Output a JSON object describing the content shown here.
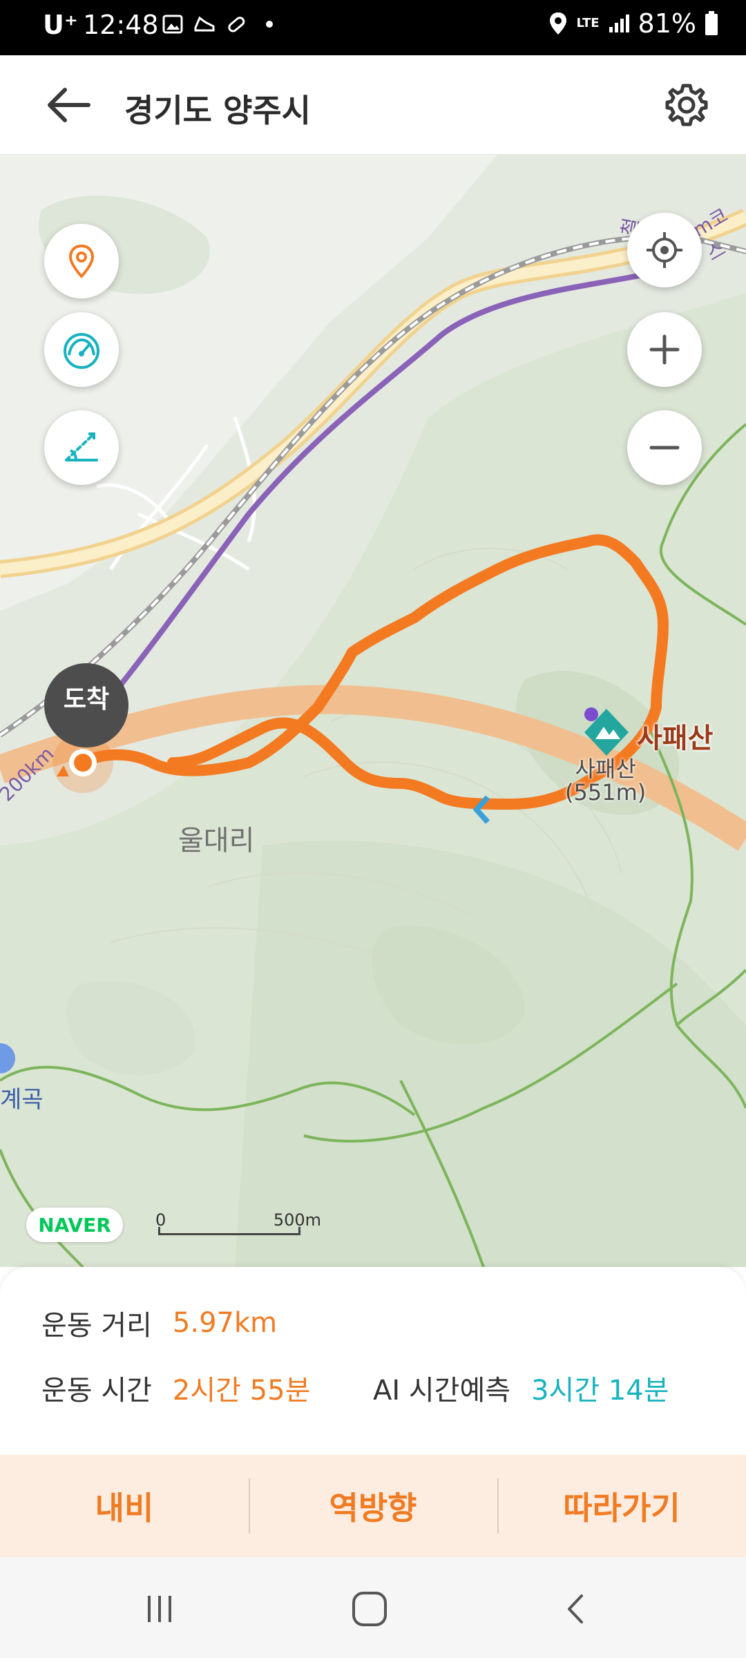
{
  "status_bar": {
    "carrier": "U⁺",
    "time": "12:48",
    "network": "LTE",
    "battery": "81%"
  },
  "header": {
    "title": "경기도 양주시",
    "back_icon": "arrow-left-icon",
    "settings_icon": "gear-icon"
  },
  "map": {
    "left_controls": [
      "location-pin-icon",
      "speedometer-icon",
      "slope-angle-icon"
    ],
    "right_controls": [
      "my-location-icon",
      "zoom-in-icon",
      "zoom-out-icon"
    ],
    "arrival_marker": "도착",
    "place_label": "울대리",
    "peak_name": "사패산",
    "peak_sub_name": "사패산",
    "peak_height": "(551m)",
    "edge_label_left": "계곡",
    "road_label": "200km",
    "road_label_top": "철",
    "road_label_top2": "m코스",
    "naver_logo": "NAVER",
    "scale_zero": "0",
    "scale_distance": "500m",
    "colors": {
      "route": "#f47a22",
      "rail": "#8a62b8",
      "highway": "#f4c98e",
      "trail": "#7cb55c"
    }
  },
  "info": {
    "distance_label": "운동 거리",
    "distance_value": "5.97km",
    "time_label": "운동 시간",
    "time_value": "2시간 55분",
    "ai_label": "AI 시간예측",
    "ai_value": "3시간 14분"
  },
  "actions": {
    "navigate": "내비",
    "reverse": "역방향",
    "follow": "따라가기"
  },
  "navbar": [
    "recent-apps-icon",
    "home-icon",
    "back-icon"
  ]
}
